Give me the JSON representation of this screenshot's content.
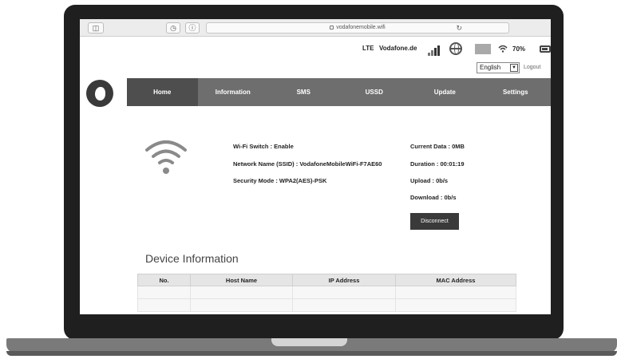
{
  "browser": {
    "url": "vodafonemobile.wifi",
    "reload_glyph": "↻",
    "sidebar_glyph": "◫",
    "history_glyph": "◷",
    "info_glyph": "ⓘ"
  },
  "status": {
    "network_type": "LTE",
    "carrier": "Vodafone.de",
    "battery_percent": "70%",
    "language": "English",
    "logout": "Logout"
  },
  "nav": {
    "items": [
      {
        "label": "Home"
      },
      {
        "label": "Information"
      },
      {
        "label": "SMS"
      },
      {
        "label": "USSD"
      },
      {
        "label": "Update"
      },
      {
        "label": "Settings"
      }
    ],
    "active": "Home"
  },
  "wifi": {
    "switch": "Wi-Fi Switch : Enable",
    "ssid": "Network Name (SSID) : VodafoneMobileWiFi-F7AE60",
    "security": "Security Mode : WPA2(AES)-PSK"
  },
  "connection": {
    "current_data": "Current Data : 0MB",
    "duration": "Duration : 00:01:19",
    "upload": "Upload : 0b/s",
    "download": "Download : 0b/s",
    "disconnect_label": "Disconnect"
  },
  "devices": {
    "title": "Device Information",
    "columns": [
      "No.",
      "Host Name",
      "IP Address",
      "MAC Address"
    ],
    "rows": [
      [
        "",
        "",
        "",
        ""
      ],
      [
        "",
        "",
        "",
        ""
      ]
    ]
  },
  "colors": {
    "nav_bg": "#6e6e6e",
    "nav_active": "#4e4e4e",
    "button_bg": "#3a3a3a"
  }
}
